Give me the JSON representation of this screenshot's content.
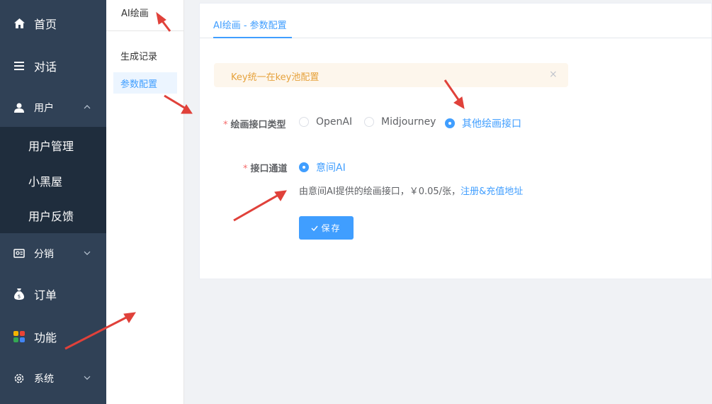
{
  "sidebar": {
    "items": [
      {
        "label": "首页",
        "icon": "home-icon"
      },
      {
        "label": "对话",
        "icon": "list-icon"
      },
      {
        "label": "用户",
        "icon": "user-icon"
      },
      {
        "label": "分销",
        "icon": "distribution-icon"
      },
      {
        "label": "订单",
        "icon": "money-bag-icon"
      },
      {
        "label": "功能",
        "icon": "grid-icon"
      },
      {
        "label": "系统",
        "icon": "gear-icon"
      }
    ],
    "user_submenu": [
      "用户管理",
      "小黑屋",
      "用户反馈"
    ]
  },
  "second_panel": {
    "title": "AI绘画",
    "items": [
      "生成记录",
      "参数配置"
    ],
    "active": "参数配置"
  },
  "main": {
    "tab": "AI绘画 - 参数配置",
    "alert": "Key统一在key池配置",
    "alert_close": "×",
    "field1": {
      "label": "绘画接口类型",
      "options": [
        "OpenAI",
        "Midjourney",
        "其他绘画接口"
      ],
      "selected": "其他绘画接口"
    },
    "field2": {
      "label": "接口通道",
      "options": [
        "意间AI"
      ],
      "selected": "意间AI"
    },
    "description": "由意间AI提供的绘画接口，￥0.05/张，",
    "description_link": "注册&充值地址",
    "save_label": "保存"
  },
  "colors": {
    "sidebar_bg": "#304156",
    "submenu_bg": "#1f2d3d",
    "accent": "#409eff",
    "alert_bg": "#fdf6ec",
    "alert_text": "#e6a23c",
    "required": "#f56c6c",
    "annotation_arrow": "#e0413a"
  }
}
